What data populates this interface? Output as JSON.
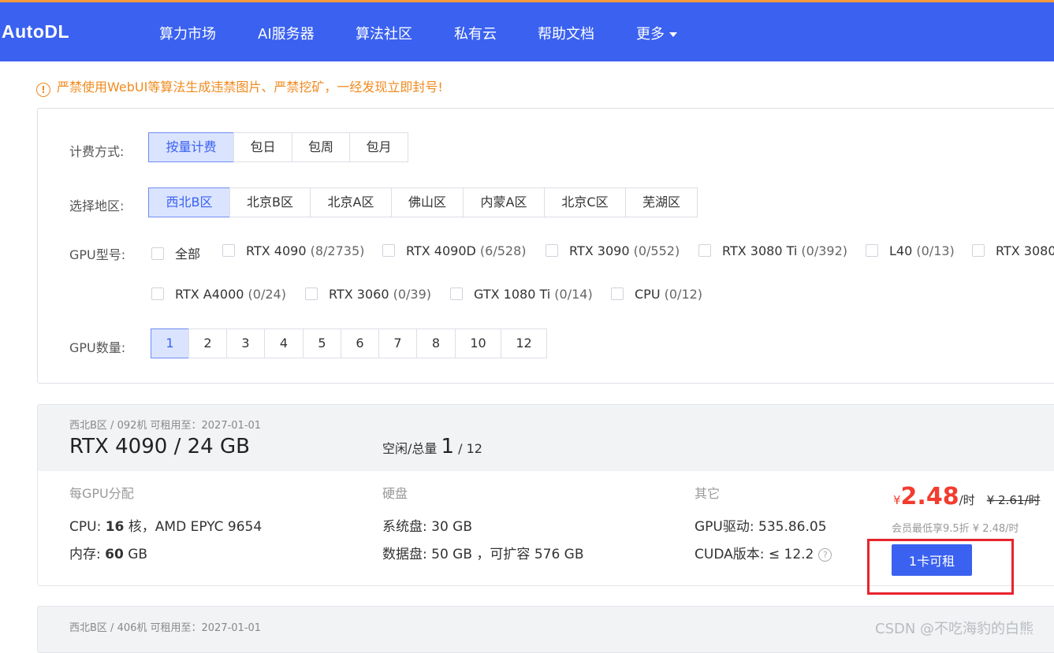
{
  "brand": "AutoDL",
  "nav": [
    "算力市场",
    "AI服务器",
    "算法社区",
    "私有云",
    "帮助文档",
    "更多"
  ],
  "notice": "严禁使用WebUI等算法生成违禁图片、严禁挖矿，一经发现立即封号!",
  "filters": {
    "billing_label": "计费方式:",
    "billing_options": [
      "按量计费",
      "包日",
      "包周",
      "包月"
    ],
    "region_label": "选择地区:",
    "region_options": [
      "西北B区",
      "北京B区",
      "北京A区",
      "佛山区",
      "内蒙A区",
      "北京C区",
      "芜湖区"
    ],
    "gpu_model_label": "GPU型号:",
    "gpu_models": [
      {
        "name": "全部",
        "count": ""
      },
      {
        "name": "RTX 4090",
        "count": "(8/2735)"
      },
      {
        "name": "RTX 4090D",
        "count": "(6/528)"
      },
      {
        "name": "RTX 3090",
        "count": "(0/552)"
      },
      {
        "name": "RTX 3080 Ti",
        "count": "(0/392)"
      },
      {
        "name": "L40",
        "count": "(0/13)"
      },
      {
        "name": "RTX 3080",
        "count": ""
      },
      {
        "name": "RTX A4000",
        "count": "(0/24)"
      },
      {
        "name": "RTX 3060",
        "count": "(0/39)"
      },
      {
        "name": "GTX 1080 Ti",
        "count": "(0/14)"
      },
      {
        "name": "CPU",
        "count": "(0/12)"
      }
    ],
    "gpu_count_label": "GPU数量:",
    "gpu_counts": [
      "1",
      "2",
      "3",
      "4",
      "5",
      "6",
      "7",
      "8",
      "10",
      "12"
    ]
  },
  "machine": {
    "meta": "西北B区 / 092机   可租用至：2027-01-01",
    "model": "RTX 4090 / 24 GB",
    "avail_label": "空闲/总量",
    "avail_free": "1",
    "avail_total": "/ 12",
    "per_gpu_title": "每GPU分配",
    "cpu_label": "CPU:",
    "cpu_cores": "16",
    "cpu_unit": "核，AMD EPYC 9654",
    "mem_label": "内存:",
    "mem_value": "60",
    "mem_unit": "GB",
    "disk_title": "硬盘",
    "sys_disk_label": "系统盘:",
    "sys_disk_value": "30 GB",
    "data_disk_label": "数据盘:",
    "data_disk_value": "50 GB ，可扩容 576 GB",
    "other_title": "其它",
    "driver_label": "GPU驱动:",
    "driver_value": "535.86.05",
    "cuda_label": "CUDA版本:",
    "cuda_value": "≤ 12.2",
    "help_icon": "?",
    "currency": "¥",
    "price": "2.48",
    "price_unit": "/时",
    "orig_price": "¥ 2.61/时",
    "member_price": "会员最低享9.5折 ¥ 2.48/时",
    "rent_button": "1卡可租"
  },
  "machine2": {
    "meta": "西北B区 / 406机   可租用至：2027-01-01"
  },
  "watermark": "CSDN @不吃海豹的白熊"
}
